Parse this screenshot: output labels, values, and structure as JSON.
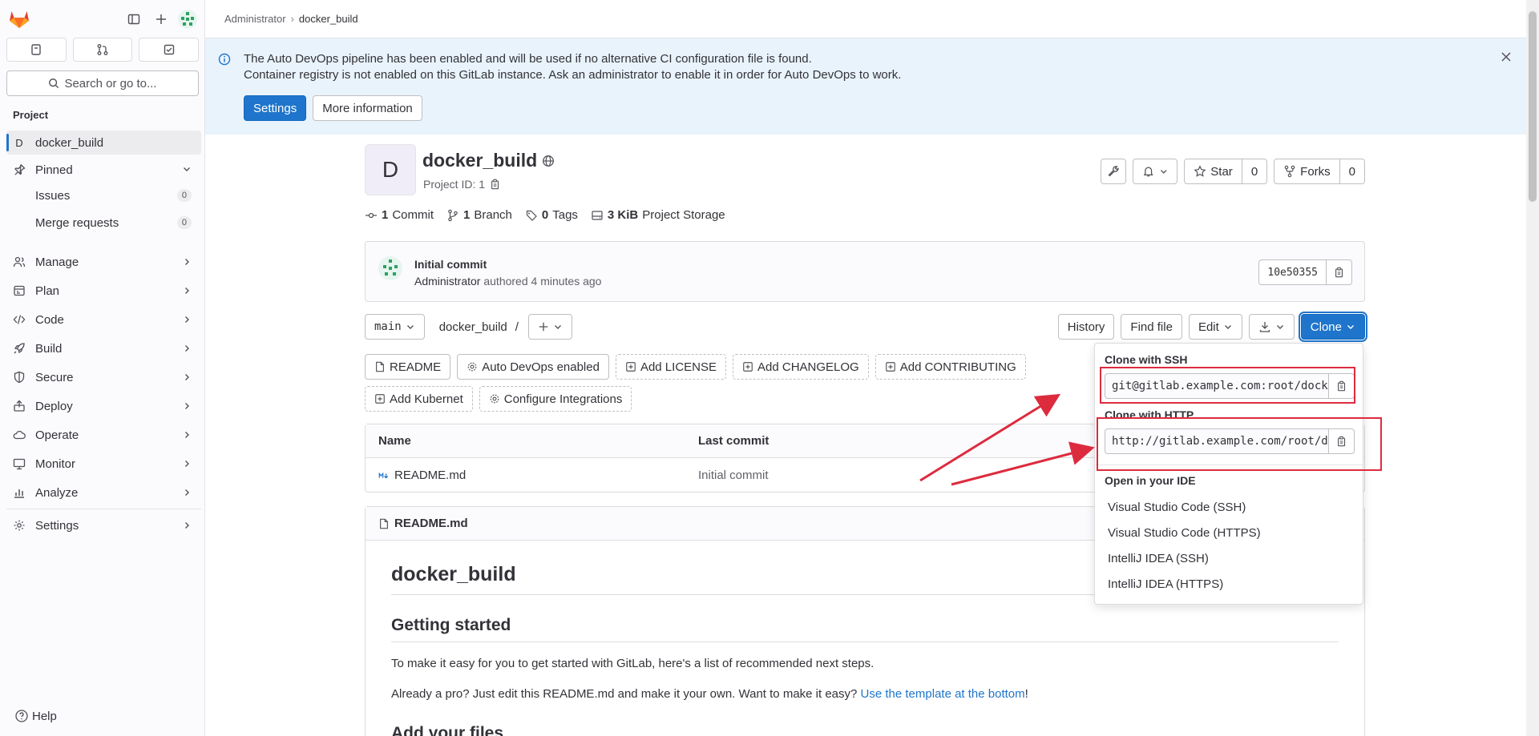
{
  "breadcrumb": [
    "Administrator",
    "docker_build"
  ],
  "sidebar": {
    "search_label": "Search or go to...",
    "section_title": "Project",
    "project_letter": "D",
    "project_name": "docker_build",
    "pinned_label": "Pinned",
    "pinned_items": [
      {
        "label": "Issues",
        "count": "0"
      },
      {
        "label": "Merge requests",
        "count": "0"
      }
    ],
    "nav": [
      "Manage",
      "Plan",
      "Code",
      "Build",
      "Secure",
      "Deploy",
      "Operate",
      "Monitor",
      "Analyze"
    ],
    "settings_label": "Settings",
    "help_label": "Help"
  },
  "banner": {
    "line1": "The Auto DevOps pipeline has been enabled and will be used if no alternative CI configuration file is found.",
    "line2": "Container registry is not enabled on this GitLab instance. Ask an administrator to enable it in order for Auto DevOps to work.",
    "settings_button": "Settings",
    "more_button": "More information"
  },
  "project": {
    "avatar_letter": "D",
    "name": "docker_build",
    "id_label": "Project ID: 1",
    "star_label": "Star",
    "star_count": "0",
    "forks_label": "Forks",
    "forks_count": "0",
    "stats": {
      "commits_num": "1",
      "commits_label": "Commit",
      "branches_num": "1",
      "branches_label": "Branch",
      "tags_num": "0",
      "tags_label": "Tags",
      "storage_num": "3 KiB",
      "storage_label": "Project Storage"
    }
  },
  "commit": {
    "title": "Initial commit",
    "author": "Administrator",
    "meta": "authored 4 minutes ago",
    "sha": "10e50355"
  },
  "tree": {
    "branch": "main",
    "path": "docker_build",
    "path_sep": "/",
    "history": "History",
    "find_file": "Find file",
    "edit": "Edit",
    "clone": "Clone"
  },
  "quick_actions": {
    "readme": "README",
    "autodevops": "Auto DevOps enabled",
    "license": "Add LICENSE",
    "changelog": "Add CHANGELOG",
    "contributing": "Add CONTRIBUTING",
    "kubernetes": "Add Kubernet",
    "integrations": "Configure Integrations"
  },
  "files": {
    "col_name": "Name",
    "col_commit": "Last commit",
    "rows": [
      {
        "name": "README.md",
        "commit": "Initial commit"
      }
    ]
  },
  "readme": {
    "file": "README.md",
    "h1": "docker_build",
    "h2": "Getting started",
    "p1": "To make it easy for you to get started with GitLab, here's a list of recommended next steps.",
    "p2_text": "Already a pro? Just edit this README.md and make it your own. Want to make it easy? ",
    "p2_link": "Use the template at the bottom",
    "p2_end": "!",
    "h2b": "Add your files"
  },
  "clone_dropdown": {
    "ssh_title": "Clone with SSH",
    "ssh_url": "git@gitlab.example.com:root/docker_build.git",
    "http_title": "Clone with HTTP",
    "http_url": "http://gitlab.example.com/root/docker_build.git",
    "ide_title": "Open in your IDE",
    "ide_items": [
      "Visual Studio Code (SSH)",
      "Visual Studio Code (HTTPS)",
      "IntelliJ IDEA (SSH)",
      "IntelliJ IDEA (HTTPS)"
    ]
  },
  "colors": {
    "accent": "#1f75cb",
    "annotation": "#dd2b3e",
    "banner_bg": "#e9f3fc"
  }
}
